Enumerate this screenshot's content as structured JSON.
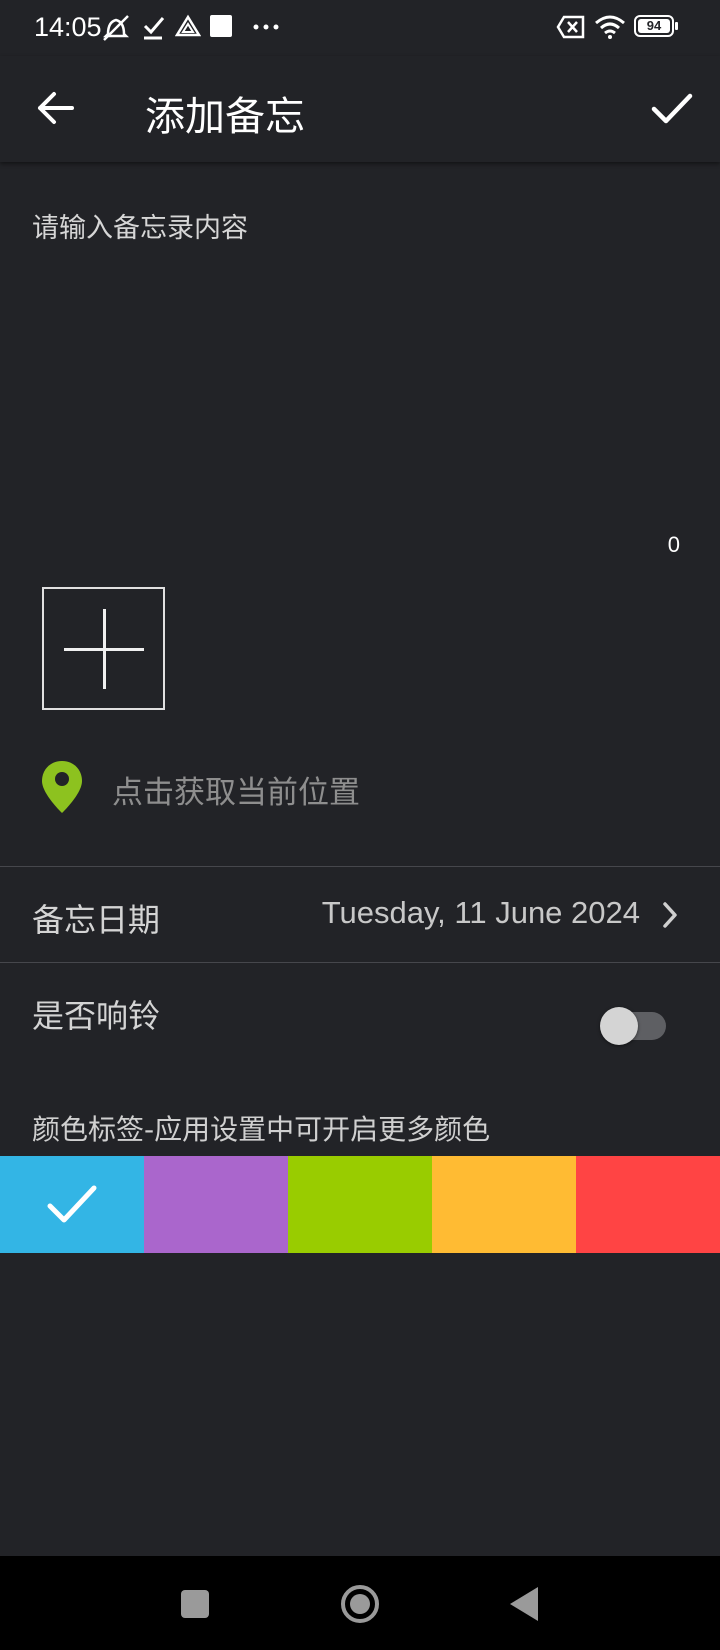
{
  "status_bar": {
    "time": "14:05",
    "battery": "94",
    "icons": [
      "mute-vibrate-icon",
      "task-check-icon",
      "drive-icon",
      "square-notification-icon",
      "more-dots-icon",
      "sim-off-icon",
      "wifi-icon",
      "battery-icon"
    ]
  },
  "toolbar": {
    "title": "添加备忘",
    "back_icon": "arrow-left-icon",
    "confirm_icon": "check-icon"
  },
  "memo": {
    "placeholder": "请输入备忘录内容",
    "value": "",
    "char_count": "0"
  },
  "photo": {
    "add_icon": "plus-icon"
  },
  "location": {
    "text": "点击获取当前位置",
    "icon_color": "#8dc21f"
  },
  "date_row": {
    "label": "备忘日期",
    "value": "Tuesday, 11 June 2024"
  },
  "ring_row": {
    "label": "是否响铃",
    "enabled": false
  },
  "color_tags": {
    "caption": "颜色标签-应用设置中可开启更多颜色",
    "selected_index": 0,
    "colors": [
      "#33b5e5",
      "#aa66cc",
      "#99cc00",
      "#ffbb33",
      "#ff4444"
    ]
  },
  "nav_bar": {
    "icons": [
      "recents-square-icon",
      "home-circle-icon",
      "back-triangle-icon"
    ]
  }
}
